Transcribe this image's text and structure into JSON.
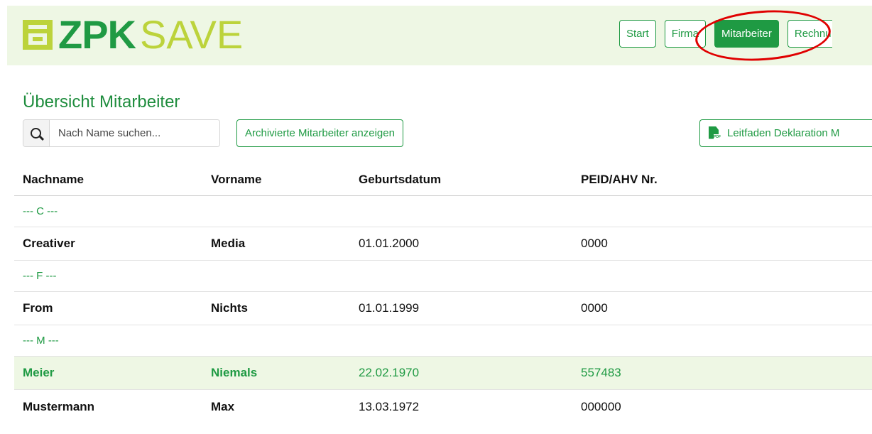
{
  "logo": {
    "part1": "ZPK",
    "part2": "SAVE"
  },
  "nav": [
    {
      "label": "Start"
    },
    {
      "label": "Firma"
    },
    {
      "label": "Mitarbeiter",
      "active": true
    },
    {
      "label": "Rechnu"
    }
  ],
  "page": {
    "title": "Übersicht Mitarbeiter"
  },
  "search": {
    "placeholder": "Nach Name suchen..."
  },
  "buttons": {
    "archive": "Archivierte Mitarbeiter anzeigen",
    "guide": "Leitfaden Deklaration M"
  },
  "table": {
    "headers": [
      "Nachname",
      "Vorname",
      "Geburtsdatum",
      "PEID/AHV Nr."
    ],
    "groups": [
      "--- C ---",
      "--- F ---",
      "--- M ---"
    ],
    "rows": [
      {
        "last": "Creativer",
        "first": "Media",
        "dob": "01.01.2000",
        "id": "0000"
      },
      {
        "last": "From",
        "first": "Nichts",
        "dob": "01.01.1999",
        "id": "0000"
      },
      {
        "last": "Meier",
        "first": "Niemals",
        "dob": "22.02.1970",
        "id": "557483"
      },
      {
        "last": "Mustermann",
        "first": "Max",
        "dob": "13.03.1972",
        "id": "000000"
      }
    ]
  },
  "colors": {
    "brand_green": "#1f9a43",
    "brand_lime": "#bcd33b",
    "header_bg": "#eef7e4",
    "highlight": "#e00000"
  },
  "icons": [
    "search-icon",
    "pdf-file-icon",
    "logo-icon"
  ]
}
